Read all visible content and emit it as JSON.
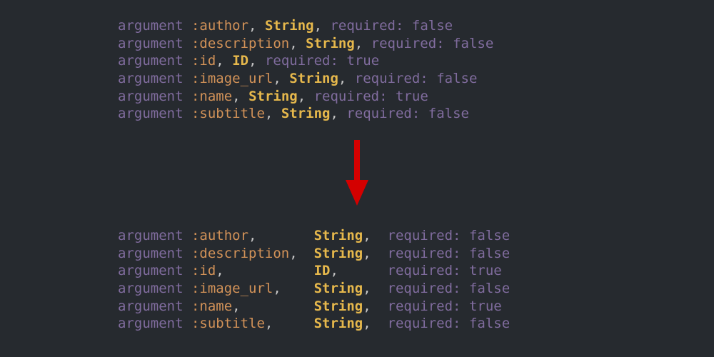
{
  "colors": {
    "bg": "#262a2f",
    "keyword": "#806c9e",
    "symbol": "#d29258",
    "type": "#e6b84c",
    "value": "#806c9e",
    "arrow": "#d40000"
  },
  "tokens": {
    "argument": "argument",
    "required": "required:",
    "true": "true",
    "false": "false",
    "String": "String",
    "ID": "ID"
  },
  "lines": [
    {
      "field": ":author",
      "type": "String",
      "required": "false"
    },
    {
      "field": ":description",
      "type": "String",
      "required": "false"
    },
    {
      "field": ":id",
      "type": "ID",
      "required": "true"
    },
    {
      "field": ":image_url",
      "type": "String",
      "required": "false"
    },
    {
      "field": ":name",
      "type": "String",
      "required": "true"
    },
    {
      "field": ":subtitle",
      "type": "String",
      "required": "false"
    }
  ],
  "aligned": {
    "field_width": 13,
    "type_width": 7
  }
}
